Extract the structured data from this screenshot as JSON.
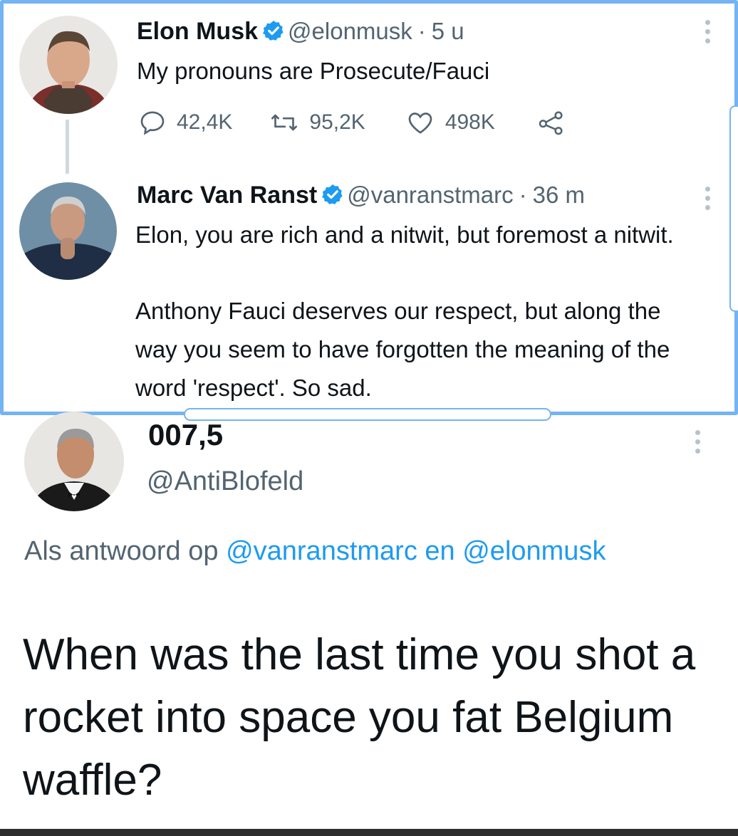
{
  "colors": {
    "accent": "#1d9bf0",
    "frame": "#74b4f2",
    "secondary_text": "#536471"
  },
  "tweet1": {
    "name": "Elon Musk",
    "handle": "@elonmusk",
    "separator": "·",
    "time": "5 u",
    "text": "My pronouns are Prosecute/Fauci",
    "replies": "42,4K",
    "retweets": "95,2K",
    "likes": "498K"
  },
  "tweet2": {
    "name": "Marc Van Ranst",
    "handle": "@vanranstmarc",
    "separator": "·",
    "time": "36 m",
    "line1": "Elon, you are rich and a nitwit, but foremost a nitwit.",
    "line2": "Anthony Fauci deserves our respect, but along the way you seem to have forgotten the meaning of the word 'respect'. So sad."
  },
  "tweet3": {
    "name": "007,5",
    "handle": "@AntiBlofeld",
    "reply_prefix": "Als antwoord op",
    "reply_mention1": "@vanranstmarc",
    "reply_joiner": "en",
    "reply_mention2": "@elonmusk",
    "text": "When was the last time you shot a rocket into space you fat Belgium waffle?"
  },
  "icons": [
    "verified-badge-icon",
    "reply-icon",
    "retweet-icon",
    "like-icon",
    "share-icon",
    "more-options-icon"
  ]
}
